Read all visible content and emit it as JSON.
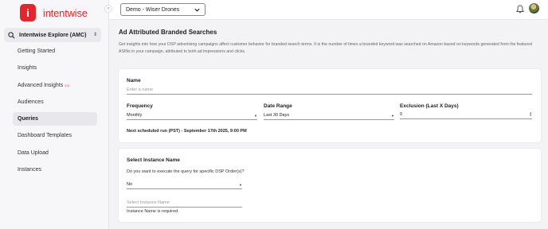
{
  "app": {
    "brand_name": "intentwise",
    "brand_logo_letter": "i",
    "brand_color": "#e3262d"
  },
  "sidebar": {
    "module": "Intentwise Explore (AMC)",
    "items": [
      {
        "label": "Getting Started",
        "badge": ""
      },
      {
        "label": "Insights",
        "badge": ""
      },
      {
        "label": "Advanced Insights",
        "badge": "2.0"
      },
      {
        "label": "Audiences",
        "badge": ""
      },
      {
        "label": "Queries",
        "badge": ""
      },
      {
        "label": "Dashboard Templates",
        "badge": ""
      },
      {
        "label": "Data Upload",
        "badge": ""
      },
      {
        "label": "Instances",
        "badge": ""
      }
    ],
    "active_item": "Queries",
    "collapse_icon": "chevron-left-icon"
  },
  "topbar": {
    "account": "Demo - Wiser Drones",
    "bell_icon": "bell-icon",
    "avatar_icon": "user-avatar"
  },
  "page": {
    "title": "Ad Attributed Branded Searches",
    "description": "Get insights into how your DSP advertising campaigns affect customer behavior for branded search terms. It is the number of times a branded keyword was searched on Amazon based on keywords generated from the featured ASINs in your campaign, attributed to both ad impressions and clicks."
  },
  "form": {
    "name_label": "Name",
    "name_placeholder": "Enter a name",
    "frequency_label": "Frequency",
    "frequency_value": "Monthly",
    "date_range_label": "Date Range",
    "date_range_value": "Last 30 Days",
    "exclusion_label": "Exclusion (Last X Days)",
    "exclusion_value": "0",
    "next_run": "Next scheduled run (PST) - September 17th 2025, 9:00 PM"
  },
  "instance": {
    "section_label": "Select Instance Name",
    "question": "Do you want to execute the query for specific DSP Order(s)?",
    "dsp_order_value": "No",
    "instance_placeholder": "Select Instance Name",
    "error": "Instance Name is required."
  }
}
